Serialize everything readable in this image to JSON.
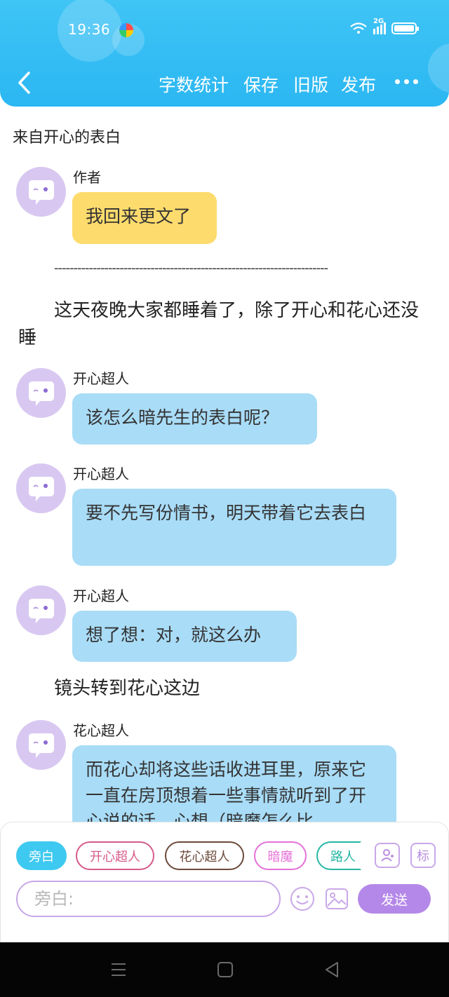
{
  "status_bar": {
    "time": "19:36",
    "network": "2G"
  },
  "header": {
    "actions": [
      "字数统计",
      "保存",
      "旧版",
      "发布"
    ]
  },
  "doc": {
    "title": "来自开心的表白"
  },
  "messages": [
    {
      "speaker": "作者",
      "text": "我回来更文了",
      "style": "yellow"
    },
    {
      "speaker": "开心超人",
      "text": "该怎么暗先生的表白呢？",
      "style": "blue"
    },
    {
      "speaker": "开心超人",
      "text": "要不先写份情书，明天带着它去表白",
      "style": "blue"
    },
    {
      "speaker": "开心超人",
      "text": "想了想：对，就这么办",
      "style": "blue"
    },
    {
      "speaker": "花心超人",
      "text": "而花心却将这些话收进耳里，原来它一直在房顶想着一些事情就听到了开心说的话，心想（暗魔怎么比",
      "style": "blue"
    }
  ],
  "divider": "-----------------------------------------------------------------------",
  "narrations": [
    "这天夜晚大家都睡着了，除了开心和花心还没睡",
    "镜头转到花心这边"
  ],
  "composer": {
    "roles": [
      "旁白",
      "开心超人",
      "花心超人",
      "暗魔",
      "路人"
    ],
    "tool_icons": [
      "add-role-icon",
      "tag-icon"
    ],
    "tag_label": "标",
    "input_placeholder": "旁白:",
    "send_label": "发送"
  },
  "colors": {
    "header": "#2bb7f2",
    "bubble_yellow": "#fddb6d",
    "bubble_blue": "#a9dcf7",
    "avatar": "#d8c8f1",
    "accent_purple": "#b488e8",
    "chip_narrator": "#3ec9f0",
    "chip_kaixin": "#d65a8a",
    "chip_huaxin": "#6b4a3a",
    "chip_anmo": "#e570d8",
    "chip_luren": "#26b6a4"
  }
}
